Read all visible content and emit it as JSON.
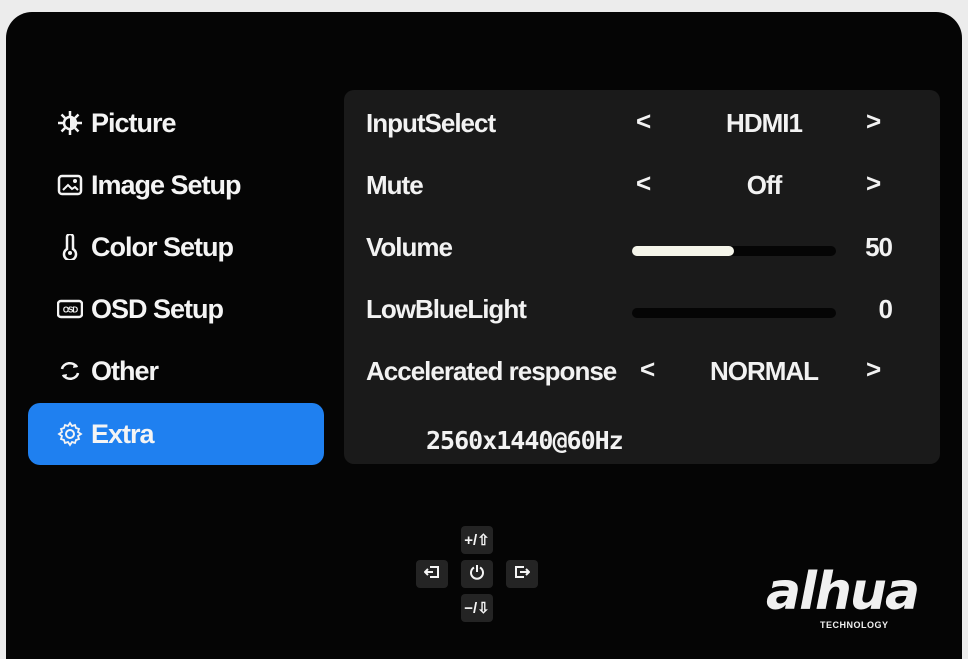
{
  "sidebar": {
    "items": [
      {
        "label": "Picture",
        "icon": "brightness-icon"
      },
      {
        "label": "Image Setup",
        "icon": "image-icon"
      },
      {
        "label": "Color Setup",
        "icon": "thermometer-icon"
      },
      {
        "label": "OSD Setup",
        "icon": "osd-icon"
      },
      {
        "label": "Other",
        "icon": "cycle-icon"
      },
      {
        "label": "Extra",
        "icon": "gear-icon"
      }
    ],
    "active_item": "Extra",
    "active_color": "#1f80f0"
  },
  "panel": {
    "input_select": {
      "label": "InputSelect",
      "value": "HDMI1",
      "prev": "<",
      "next": ">"
    },
    "mute": {
      "label": "Mute",
      "value": "Off",
      "prev": "<",
      "next": ">"
    },
    "volume": {
      "label": "Volume",
      "value": "50",
      "level": 50
    },
    "low_blue_light": {
      "label": "LowBlueLight",
      "value": "0",
      "level": 0
    },
    "accelerated_response": {
      "label": "Accelerated response",
      "value": "NORMAL",
      "prev": "<",
      "next": ">"
    },
    "resolution": "2560x1440@60Hz"
  },
  "keypad": {
    "up": "+/⇧",
    "down": "−/⇩",
    "left_icon": "exit-icon",
    "right_icon": "enter-icon",
    "center_icon": "power-icon"
  },
  "logo": {
    "brand": "alhua",
    "tagline": "TECHNOLOGY"
  }
}
